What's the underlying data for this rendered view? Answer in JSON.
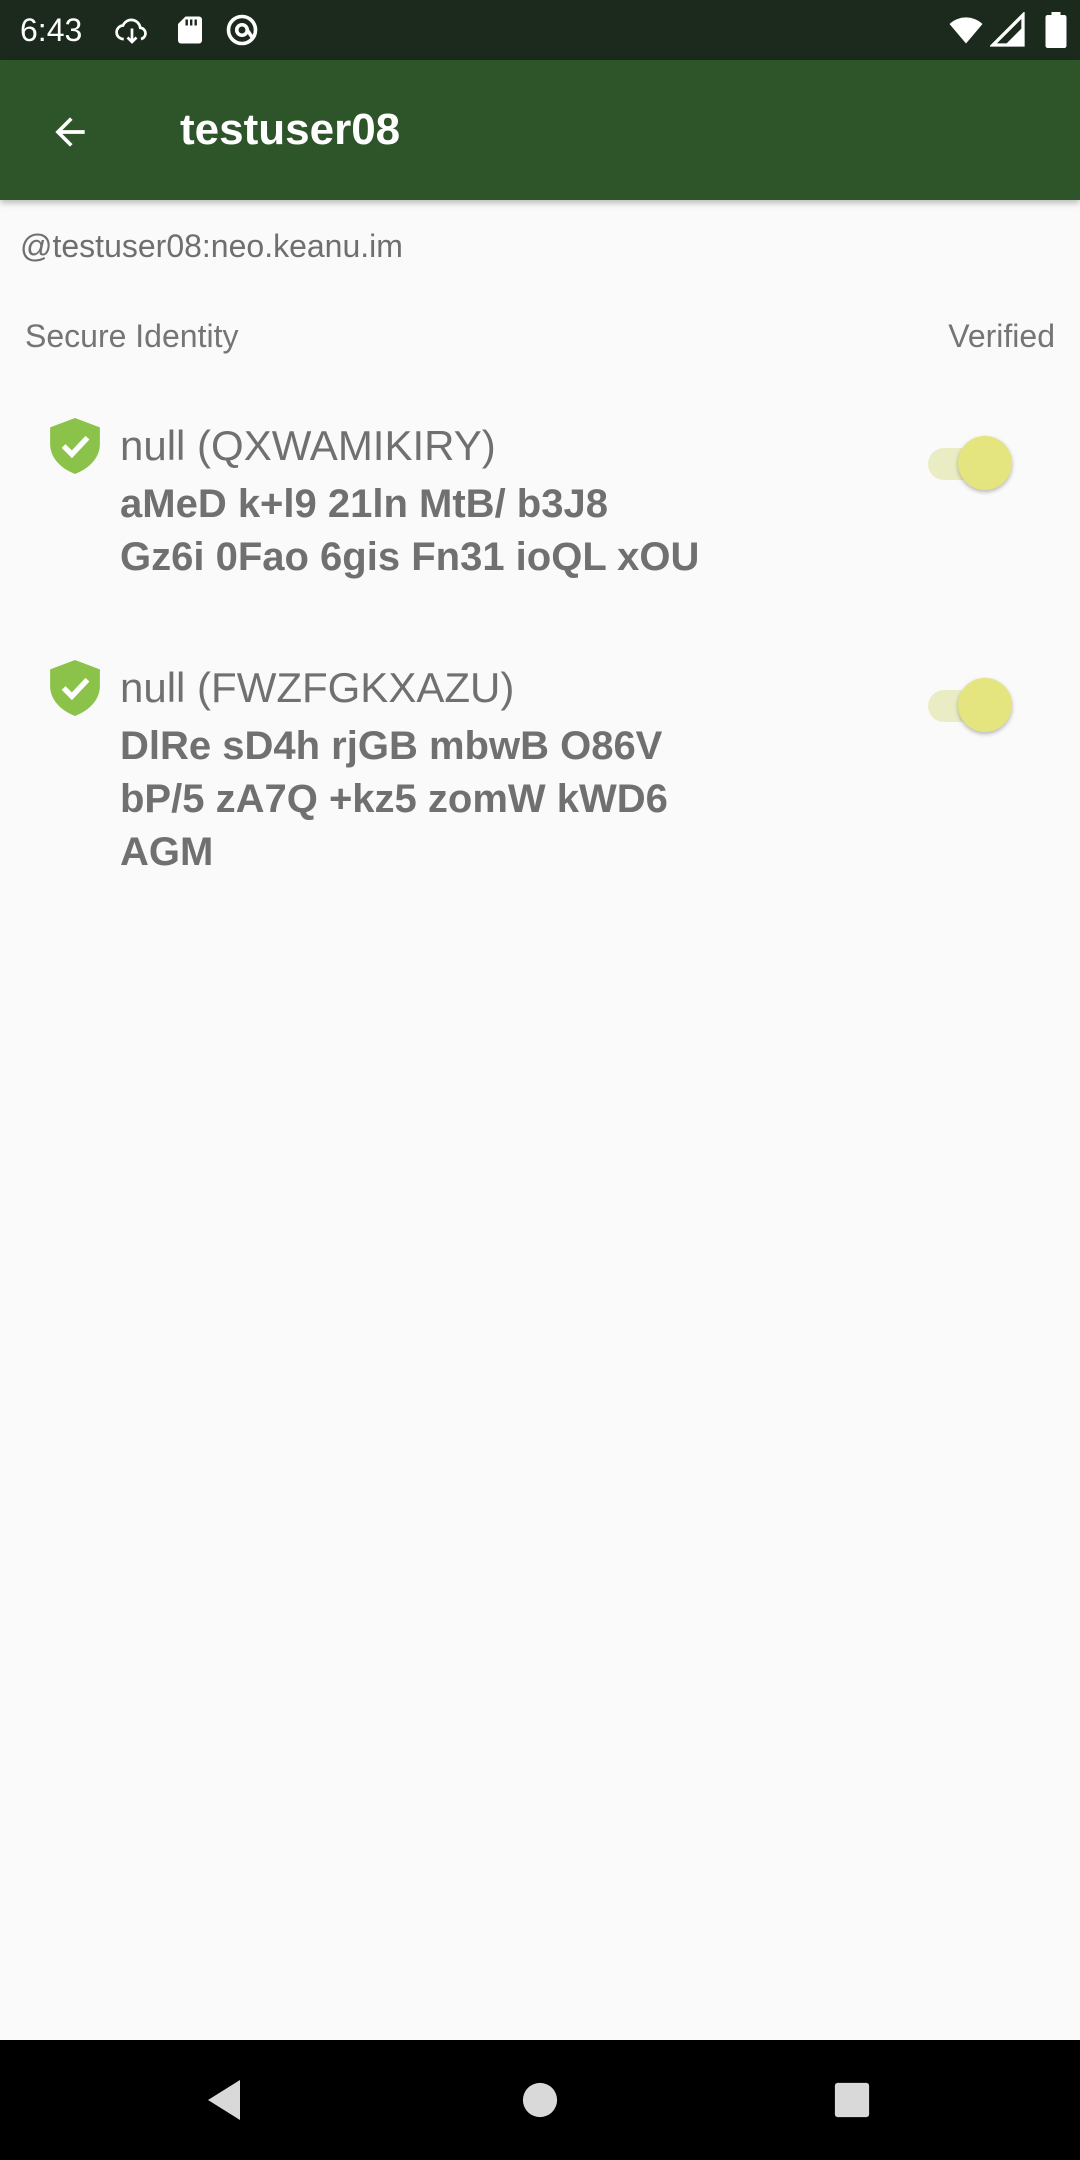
{
  "status_bar": {
    "time": "6:43",
    "icons": [
      "cloud-download-icon",
      "sd-card-icon",
      "at-sign-icon",
      "wifi-icon",
      "signal-icon",
      "battery-icon"
    ]
  },
  "app_bar": {
    "title": "testuser08",
    "back_icon": "arrow-left-icon",
    "background": "#2e552a"
  },
  "user_id": "@testuser08:neo.keanu.im",
  "section": {
    "left_label": "Secure Identity",
    "right_label": "Verified"
  },
  "devices": [
    {
      "name": "null (QXWAMIKIRY)",
      "fingerprint_line1": "aMeD k+l9 21ln MtB/ b3J8",
      "fingerprint_line2": "Gz6i 0Fao 6gis Fn31 ioQL xOU",
      "fingerprint_line3": "",
      "verified": true,
      "icon": "verified-shield-icon"
    },
    {
      "name": "null (FWZFGKXAZU)",
      "fingerprint_line1": "DlRe sD4h rjGB mbwB O86V",
      "fingerprint_line2": "bP/5 zA7Q +kz5 zomW kWD6",
      "fingerprint_line3": "AGM",
      "verified": true,
      "icon": "verified-shield-icon"
    }
  ],
  "colors": {
    "shield": "#8bc34a",
    "toggle_thumb": "#e4e57e",
    "toggle_track": "#eaedc4"
  },
  "nav_bar": {
    "icons": [
      "nav-back-icon",
      "nav-home-icon",
      "nav-recent-icon"
    ]
  }
}
